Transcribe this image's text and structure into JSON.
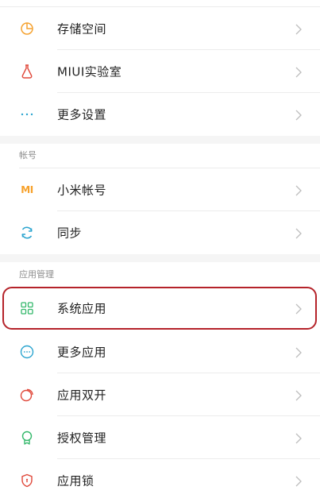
{
  "colors": {
    "accent_orange": "#f5a230",
    "accent_blue": "#2aa4cf",
    "accent_green": "#34b86b",
    "accent_red": "#e0483a",
    "chevron": "#bdbdbd",
    "highlight": "#b5232a"
  },
  "top_items": [
    {
      "label": "存储空间",
      "icon": "storage-pie-icon"
    },
    {
      "label": "MIUI实验室",
      "icon": "flask-icon"
    },
    {
      "label": "更多设置",
      "icon": "more-dots-icon"
    }
  ],
  "account_section": {
    "title": "帐号",
    "items": [
      {
        "label": "小米帐号",
        "icon": "mi-logo-icon",
        "icon_text": "MI"
      },
      {
        "label": "同步",
        "icon": "sync-icon"
      }
    ]
  },
  "apps_section": {
    "title": "应用管理",
    "items": [
      {
        "label": "系统应用",
        "icon": "grid-apps-icon"
      },
      {
        "label": "更多应用",
        "icon": "more-circle-icon"
      },
      {
        "label": "应用双开",
        "icon": "dual-app-icon"
      },
      {
        "label": "授权管理",
        "icon": "badge-icon"
      },
      {
        "label": "应用锁",
        "icon": "shield-lock-icon"
      }
    ]
  }
}
